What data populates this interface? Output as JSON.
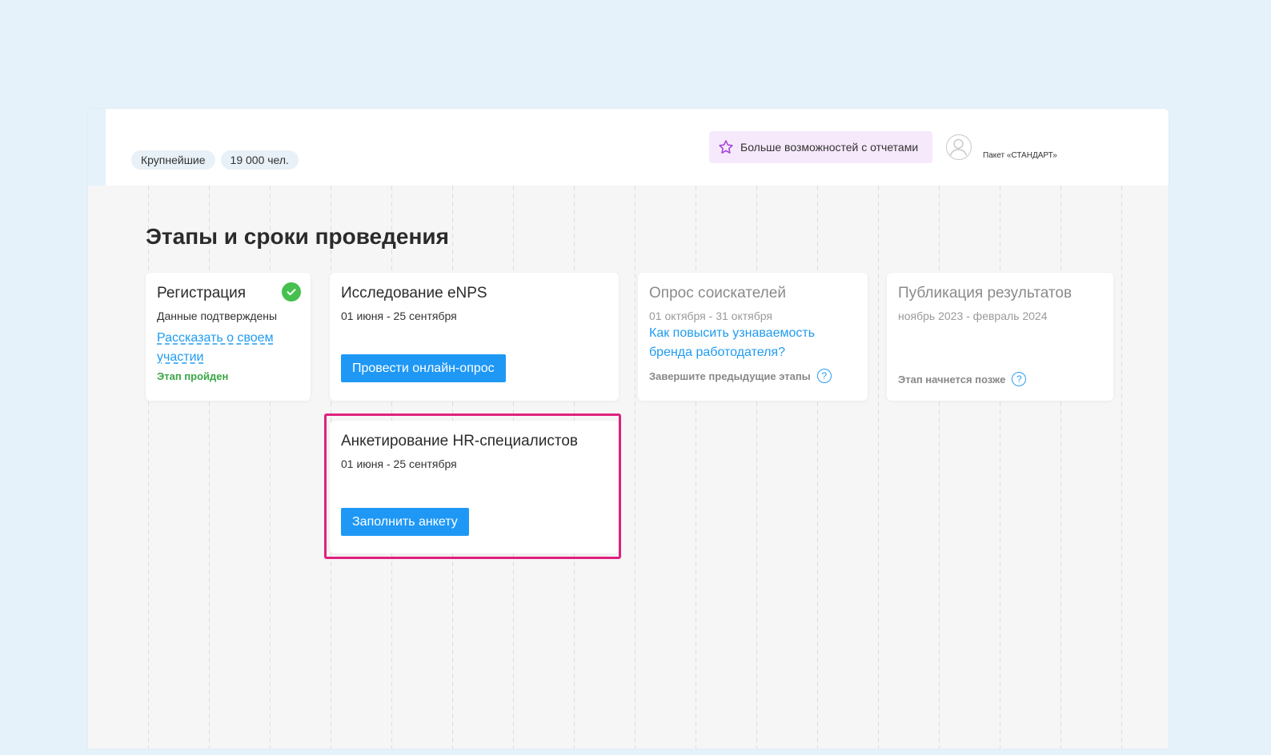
{
  "header": {
    "chips": [
      "Крупнейшие",
      "19 000 чел."
    ],
    "promo_label": "Больше возможностей с отчетами",
    "package_label": "Пакет «СТАНДАРТ»"
  },
  "page_title": "Этапы и сроки проведения",
  "cards": {
    "registration": {
      "title": "Регистрация",
      "subtitle": "Данные подтверждены",
      "link": "Рассказать о своем участии",
      "status": "Этап пройден"
    },
    "enps": {
      "title": "Исследование eNPS",
      "dates": "01 июня - 25 сентября",
      "button": "Провести онлайн-опрос"
    },
    "candidates": {
      "title": "Опрос соискателей",
      "dates": "01 октября - 31 октября",
      "link": "Как повысить узнаваемость бренда работодателя?",
      "status": "Завершите предыдущие этапы"
    },
    "publication": {
      "title": "Публикация результатов",
      "dates": "ноябрь 2023 - февраль 2024",
      "status": "Этап начнется позже"
    },
    "hr_survey": {
      "title": "Анкетирование HR-специалистов",
      "dates": "01 июня - 25 сентября",
      "button": "Заполнить анкету"
    }
  },
  "colors": {
    "accent_blue": "#1f98f5",
    "success_green": "#46c04f",
    "highlight_pink": "#e0207e",
    "promo_bg": "#f6e9fb"
  }
}
